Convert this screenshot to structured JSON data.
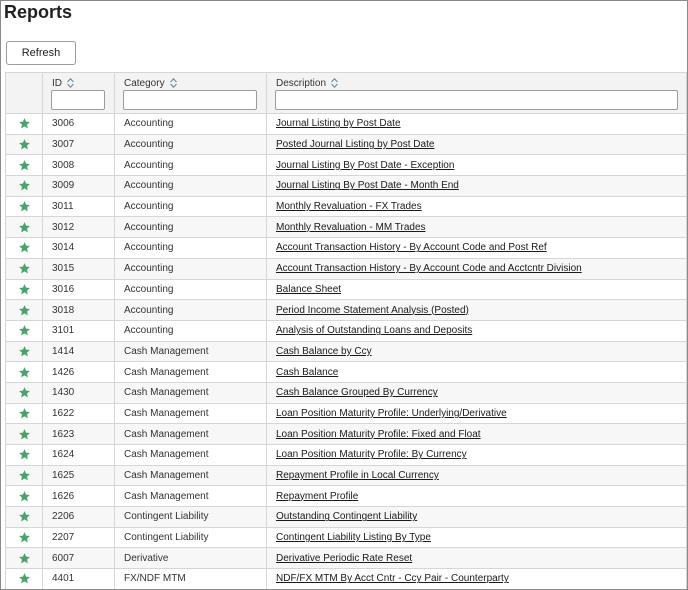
{
  "page": {
    "title": "Reports"
  },
  "toolbar": {
    "refresh_label": "Refresh"
  },
  "colors": {
    "star": "#4aa36a",
    "link": "#1a1a1a",
    "header_bg": "#f3f3f3"
  },
  "table": {
    "columns": {
      "id": "ID",
      "category": "Category",
      "description": "Description"
    },
    "filters": {
      "id": "",
      "category": "",
      "description": ""
    },
    "rows": [
      {
        "id": "3006",
        "category": "Accounting",
        "description": "Journal Listing by Post Date"
      },
      {
        "id": "3007",
        "category": "Accounting",
        "description": "Posted Journal Listing by Post Date"
      },
      {
        "id": "3008",
        "category": "Accounting",
        "description": "Journal Listing By Post Date - Exception"
      },
      {
        "id": "3009",
        "category": "Accounting",
        "description": "Journal Listing By Post Date - Month End"
      },
      {
        "id": "3011",
        "category": "Accounting",
        "description": "Monthly Revaluation - FX Trades"
      },
      {
        "id": "3012",
        "category": "Accounting",
        "description": "Monthly Revaluation - MM Trades"
      },
      {
        "id": "3014",
        "category": "Accounting",
        "description": "Account Transaction History - By Account Code and Post Ref"
      },
      {
        "id": "3015",
        "category": "Accounting",
        "description": "Account Transaction History - By Account Code and Acctcntr Division"
      },
      {
        "id": "3016",
        "category": "Accounting",
        "description": "Balance Sheet"
      },
      {
        "id": "3018",
        "category": "Accounting",
        "description": "Period Income Statement Analysis (Posted)"
      },
      {
        "id": "3101",
        "category": "Accounting",
        "description": "Analysis of Outstanding Loans and Deposits"
      },
      {
        "id": "1414",
        "category": "Cash Management",
        "description": "Cash Balance by Ccy"
      },
      {
        "id": "1426",
        "category": "Cash Management",
        "description": "Cash Balance"
      },
      {
        "id": "1430",
        "category": "Cash Management",
        "description": "Cash Balance Grouped By Currency"
      },
      {
        "id": "1622",
        "category": "Cash Management",
        "description": "Loan Position Maturity Profile: Underlying/Derivative"
      },
      {
        "id": "1623",
        "category": "Cash Management",
        "description": "Loan Position Maturity Profile: Fixed and Float"
      },
      {
        "id": "1624",
        "category": "Cash Management",
        "description": "Loan Position Maturity Profile: By Currency"
      },
      {
        "id": "1625",
        "category": "Cash Management",
        "description": "Repayment Profile in Local Currency"
      },
      {
        "id": "1626",
        "category": "Cash Management",
        "description": "Repayment Profile"
      },
      {
        "id": "2206",
        "category": "Contingent Liability",
        "description": "Outstanding Contingent Liability"
      },
      {
        "id": "2207",
        "category": "Contingent Liability",
        "description": "Contingent Liability Listing By Type"
      },
      {
        "id": "6007",
        "category": "Derivative",
        "description": "Derivative Periodic Rate Reset"
      },
      {
        "id": "4401",
        "category": "FX/NDF MTM",
        "description": "NDF/FX MTM By Acct Cntr - Ccy Pair - Counterparty"
      }
    ]
  }
}
